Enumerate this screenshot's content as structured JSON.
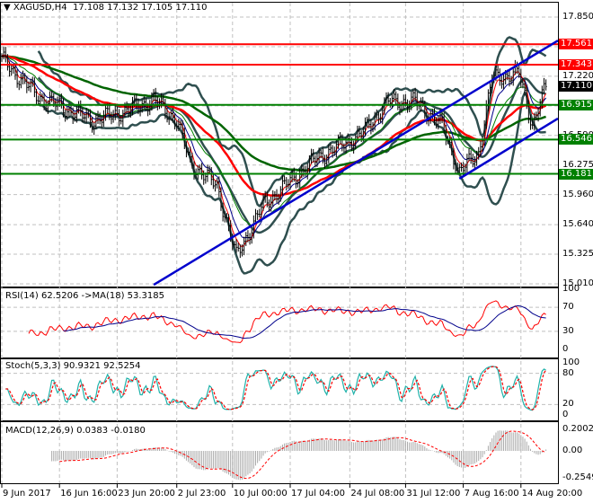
{
  "header": {
    "arrow_icon": "triangle-down",
    "symbol": "XAGUSD,H4",
    "ohlc": "17.108 17.132 17.105 17.110"
  },
  "colors": {
    "bars": "#000000",
    "bands": "#2f4f4f",
    "ma_fast": "#ff0000",
    "ma_mid": "#00008b",
    "ma_slow": "#008000",
    "ma_long_red": "#ff0000",
    "ma_long_green": "#006400",
    "trend": "#0000cd",
    "res": "#ff0000",
    "sup": "#008000",
    "grid": "#c0c0c0"
  },
  "chart_data": {
    "type": "line",
    "title": "XAGUSD,H4",
    "bar_count": 290,
    "price_waypoints": [
      [
        0,
        17.4
      ],
      [
        19,
        17.0
      ],
      [
        47,
        16.75
      ],
      [
        65,
        16.85
      ],
      [
        79,
        16.97
      ],
      [
        91,
        16.75
      ],
      [
        98,
        16.3
      ],
      [
        112,
        16.05
      ],
      [
        122,
        15.3
      ],
      [
        136,
        15.85
      ],
      [
        150,
        16.1
      ],
      [
        164,
        16.35
      ],
      [
        187,
        16.6
      ],
      [
        201,
        16.95
      ],
      [
        215,
        16.95
      ],
      [
        229,
        16.7
      ],
      [
        238,
        16.2
      ],
      [
        248,
        16.4
      ],
      [
        255,
        17.2
      ],
      [
        269,
        17.25
      ],
      [
        276,
        16.7
      ],
      [
        283,
        17.11
      ]
    ],
    "ylim": [
      15.01,
      17.85
    ],
    "y_ticks": [
      "17.850",
      "17.535",
      "17.220",
      "16.905",
      "16.590",
      "16.275",
      "15.960",
      "15.640",
      "15.325",
      "15.010"
    ],
    "x_ticks": [
      {
        "bar": 0,
        "label": "9 Jun 2017"
      },
      {
        "bar": 30,
        "label": "16 Jun 16:00"
      },
      {
        "bar": 60,
        "label": "23 Jun 20:00"
      },
      {
        "bar": 91,
        "label": "2 Jul 23:00"
      },
      {
        "bar": 120,
        "label": "10 Jul 00:00"
      },
      {
        "bar": 150,
        "label": "17 Jul 04:00"
      },
      {
        "bar": 181,
        "label": "24 Jul 08:00"
      },
      {
        "bar": 210,
        "label": "31 Jul 12:00"
      },
      {
        "bar": 240,
        "label": "7 Aug 16:00"
      },
      {
        "bar": 270,
        "label": "14 Aug 20:00"
      }
    ],
    "horizontal_levels": [
      {
        "price": 17.561,
        "label": "17.561",
        "kind": "resistance"
      },
      {
        "price": 17.343,
        "label": "17.343",
        "kind": "resistance"
      },
      {
        "price": 16.915,
        "label": "16.915",
        "kind": "support"
      },
      {
        "price": 16.546,
        "label": "16.546",
        "kind": "support"
      },
      {
        "price": 16.181,
        "label": "16.181",
        "kind": "support"
      }
    ],
    "current_price": {
      "price": 17.11,
      "label": "17.110"
    },
    "trendlines": [
      [
        [
          79,
          15.0
        ],
        [
          290,
          17.6
        ]
      ],
      [
        [
          238,
          16.13
        ],
        [
          290,
          16.77
        ]
      ]
    ],
    "indicators": {
      "rsi": {
        "label": "RSI(14) 62.5206  ->MA(18) 53.3185",
        "ticks": [
          "100",
          "70",
          "30",
          "0"
        ]
      },
      "stoch": {
        "label": "Stoch(5,3,3) 90.9321 92.5254",
        "ticks": [
          "100",
          "80",
          "20",
          "0"
        ]
      },
      "macd": {
        "label": "MACD(12,26,9) 0.0383 -0.0180",
        "ticks": [
          "0.2002",
          "0.00",
          "-0.2549"
        ]
      }
    }
  }
}
